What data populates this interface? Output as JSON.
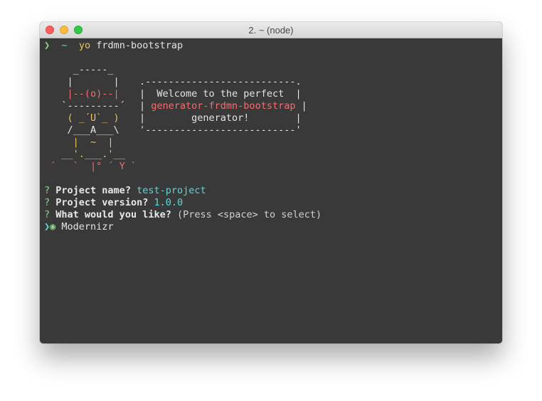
{
  "window": {
    "title": "2. ~ (node)"
  },
  "prompt": {
    "arrow": "❯",
    "cwd": "~",
    "command": "yo",
    "argument": "frdmn-bootstrap"
  },
  "ascii_art": {
    "robot": {
      "hat_top": "     _-----_",
      "hat_side1": "    |       |",
      "hat_eyes": "    |--(o)--|",
      "face_top": "   `---------´",
      "mouth": "    ( _´U`_ )",
      "shoulders": "    /___A___\\",
      "belly": "     |  ~  |",
      "arms": "   __'.___.'__",
      "feet": " ´   `  |° ´ Y `"
    },
    "box_top": ".--------------------------.",
    "box_line1_left": "|  ",
    "box_line1_text": "Welcome to the perfect",
    "box_line1_right": "  |",
    "box_line2_left": "| ",
    "box_line2_text": "generator-frdmn-bootstrap",
    "box_line2_right": " |",
    "box_line3_left": "|        ",
    "box_line3_text": "generator!",
    "box_line3_right": "        |",
    "box_bottom": "'--------------------------'"
  },
  "questions": [
    {
      "mark": "?",
      "label": "Project name?",
      "answer": "test-project"
    },
    {
      "mark": "?",
      "label": "Project version?",
      "answer": "1.0.0"
    },
    {
      "mark": "?",
      "label": "What would you like?",
      "hint": "(Press <space> to select)"
    }
  ],
  "choices": [
    {
      "pointer": "❯",
      "radio": "◉",
      "label": "Modernizr"
    }
  ]
}
